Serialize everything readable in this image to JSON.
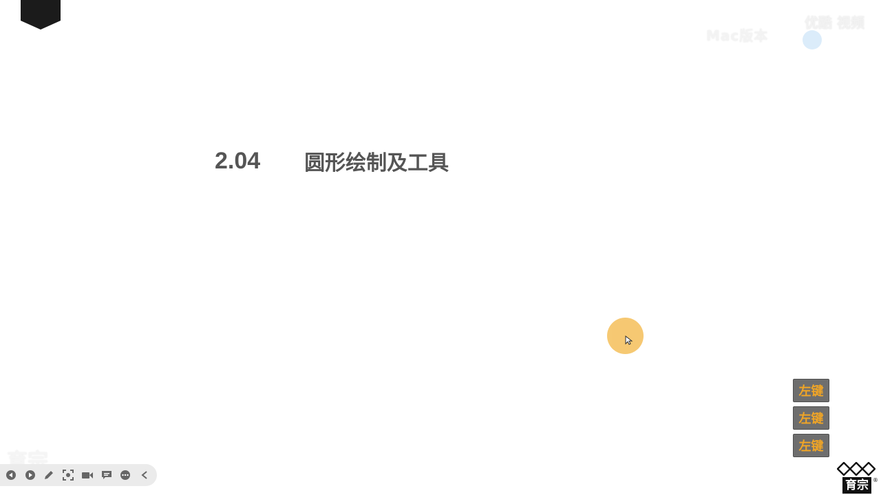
{
  "badge": {
    "icon": "black-pentagon-badge"
  },
  "watermark_top": {
    "text": "Mac版本",
    "logo_text": "优酷 视频"
  },
  "slide": {
    "number": "2.04",
    "title": "圆形绘制及工具"
  },
  "cursor": {
    "icon": "pointer-cursor",
    "halo_color": "#f6c66b"
  },
  "key_indicators": [
    "左键",
    "左键",
    "左键"
  ],
  "watermark_bottom": {
    "text": "育宗"
  },
  "toolbar": {
    "buttons": [
      {
        "name": "prev-icon"
      },
      {
        "name": "next-icon"
      },
      {
        "name": "pen-icon"
      },
      {
        "name": "screenshot-icon"
      },
      {
        "name": "video-camera-icon"
      },
      {
        "name": "comment-icon"
      },
      {
        "name": "more-icon"
      },
      {
        "name": "collapse-icon"
      }
    ]
  },
  "brand": {
    "name": "育宗",
    "mark": "®"
  },
  "colors": {
    "title": "#555555",
    "key_text": "#f0a526",
    "key_bg": "#6e6e6e"
  }
}
